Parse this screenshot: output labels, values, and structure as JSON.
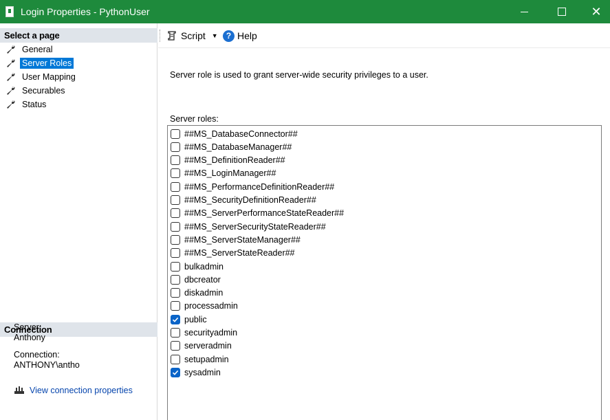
{
  "window": {
    "title": "Login Properties - PythonUser",
    "title_bar_color": "#1e8a3c"
  },
  "sidebar": {
    "select_page_header": "Select a page",
    "items": [
      {
        "label": "General",
        "icon": "wrench-icon",
        "selected": false
      },
      {
        "label": "Server Roles",
        "icon": "wrench-icon",
        "selected": true
      },
      {
        "label": "User Mapping",
        "icon": "wrench-icon",
        "selected": false
      },
      {
        "label": "Securables",
        "icon": "wrench-icon",
        "selected": false
      },
      {
        "label": "Status",
        "icon": "wrench-icon",
        "selected": false
      }
    ],
    "connection_header": "Connection",
    "server_label": "Server:",
    "server_value": "Anthony",
    "connection_label": "Connection:",
    "connection_value": "ANTHONY\\antho",
    "view_connection_properties": "View connection properties"
  },
  "toolbar": {
    "script_label": "Script",
    "help_label": "Help"
  },
  "main": {
    "description": "Server role is used to grant server-wide security privileges to a user.",
    "roles_label": "Server roles:",
    "roles": [
      {
        "name": "##MS_DatabaseConnector##",
        "checked": false
      },
      {
        "name": "##MS_DatabaseManager##",
        "checked": false
      },
      {
        "name": "##MS_DefinitionReader##",
        "checked": false
      },
      {
        "name": "##MS_LoginManager##",
        "checked": false
      },
      {
        "name": "##MS_PerformanceDefinitionReader##",
        "checked": false
      },
      {
        "name": "##MS_SecurityDefinitionReader##",
        "checked": false
      },
      {
        "name": "##MS_ServerPerformanceStateReader##",
        "checked": false
      },
      {
        "name": "##MS_ServerSecurityStateReader##",
        "checked": false
      },
      {
        "name": "##MS_ServerStateManager##",
        "checked": false
      },
      {
        "name": "##MS_ServerStateReader##",
        "checked": false
      },
      {
        "name": "bulkadmin",
        "checked": false
      },
      {
        "name": "dbcreator",
        "checked": false
      },
      {
        "name": "diskadmin",
        "checked": false
      },
      {
        "name": "processadmin",
        "checked": false
      },
      {
        "name": "public",
        "checked": true
      },
      {
        "name": "securityadmin",
        "checked": false
      },
      {
        "name": "serveradmin",
        "checked": false
      },
      {
        "name": "setupadmin",
        "checked": false
      },
      {
        "name": "sysadmin",
        "checked": true
      }
    ]
  }
}
